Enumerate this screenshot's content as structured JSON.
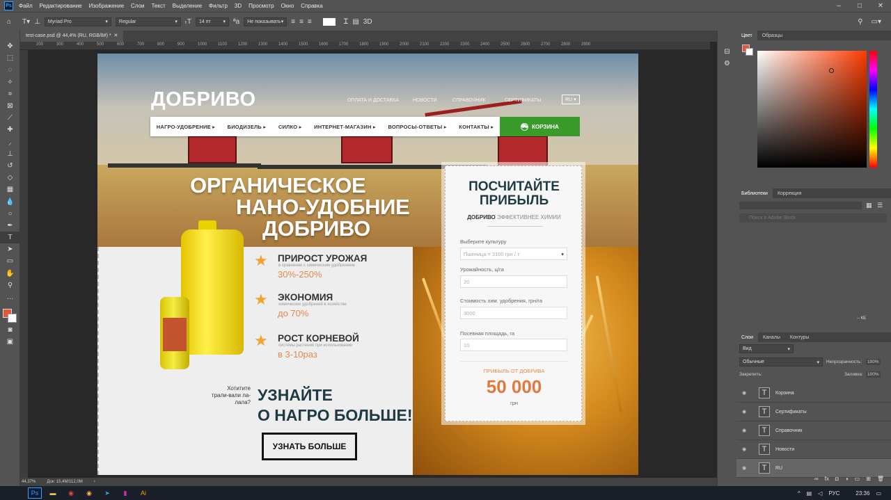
{
  "menubar": {
    "app_icon": "Ps",
    "items": [
      "Файл",
      "Редактирование",
      "Изображение",
      "Слои",
      "Текст",
      "Выделение",
      "Фильтр",
      "3D",
      "Просмотр",
      "Окно",
      "Справка"
    ]
  },
  "options": {
    "font_family": "Myriad Pro",
    "font_style": "Regular",
    "font_size": "14 пт",
    "antialias": "Не показывать",
    "mode_3d": "3D"
  },
  "document": {
    "tab_title": "test-case.psd @ 44,4% (RU, RGB/8#) *",
    "zoom": "44,37%",
    "doc_size": "Док: 15,4M/112,0M"
  },
  "ruler": [
    "200",
    "300",
    "400",
    "500",
    "600",
    "700",
    "800",
    "900",
    "1000",
    "1100",
    "1200",
    "1300",
    "1400",
    "1500",
    "1600",
    "1700",
    "1800",
    "1900",
    "2000",
    "2100",
    "2200",
    "2300",
    "2400",
    "2500",
    "2600",
    "2700",
    "2800",
    "2900"
  ],
  "site": {
    "logo": "ДОБРИВО",
    "top_links": [
      "ОПЛАТА И ДОСТАВКА",
      "НОВОСТИ",
      "СПРАВОЧНИК",
      "СЕРТИФИКАТЫ"
    ],
    "lang": "RU",
    "nav": [
      "НАГРО-УДОБРЕНИЕ",
      "БИОДИЗЕЛЬ",
      "СИЛКО",
      "ИНТЕРНЕТ-МАГАЗИН",
      "ВОПРОСЫ-ОТВЕТЫ",
      "КОНТАКТЫ"
    ],
    "cart": "КОРЗИНА",
    "headline": [
      "ОРГАНИЧЕСКОЕ",
      "НАНО-УДОБНИЕ",
      "ДОБРИВО"
    ],
    "features": [
      {
        "title": "ПРИРОСТ УРОЖАЯ",
        "sub": "в сравнении с химическим удобрением",
        "value": "30%-250%"
      },
      {
        "title": "ЭКОНОМИЯ",
        "sub": "химических удобрений в хозяйстве",
        "value": "до 70%"
      },
      {
        "title": "РОСТ КОРНЕВОЙ",
        "sub": "системы растений при использовании",
        "value": "в 3-10раз"
      }
    ],
    "ask": "Хотитите трали-вали ла-лала?",
    "learn": [
      "УЗНАЙТЕ",
      "О НАГРО БОЛЬШЕ!"
    ],
    "learn_button": "УЗНАТЬ БОЛЬШЕ",
    "calc": {
      "title": [
        "ПОСЧИТАЙТЕ",
        "ПРИБЫЛЬ"
      ],
      "sub_bold": "ДОБРИВО",
      "sub_rest": "ЭФФЕКТИВНЕЕ ХИМИИ",
      "culture_label": "Выберите культуру",
      "culture_value": "Пшеница = 3100 грн / т",
      "yield_label": "Урожайность, ц/га",
      "yield_value": "20",
      "cost_label": "Стоимость хим. удобрения, грн/га",
      "cost_value": "3000",
      "area_label": "Посевная площадь, га",
      "area_value": "10",
      "profit_label": "ПРИБЫЛЬ ОТ ДОБРИВА",
      "profit_value": "50 000",
      "profit_unit": "грн"
    }
  },
  "panels": {
    "color_tabs": [
      "Цвет",
      "Образцы"
    ],
    "lib_tabs": [
      "Библиотеки",
      "Коррекция"
    ],
    "lib_search": "Поиск в Adobe Stock",
    "lib_size": "-- КБ",
    "layer_tabs": [
      "Слои",
      "Каналы",
      "Контуры"
    ],
    "kind": "Вид",
    "blend": "Обычные",
    "opacity_label": "Непрозрачность:",
    "opacity": "100%",
    "lock_label": "Закрепить:",
    "fill_label": "Заливка:",
    "fill": "100%",
    "layers": [
      "Корзина",
      "Сертификаты",
      "Справочник",
      "Новости",
      "RU"
    ]
  },
  "taskbar": {
    "lang": "РУС",
    "time": "23:36"
  },
  "colors": {
    "accent_orange": "#e3783d",
    "cart_green": "#3a9a2a",
    "headline_navy": "#1d3a45",
    "foreground": "#e8553a"
  }
}
